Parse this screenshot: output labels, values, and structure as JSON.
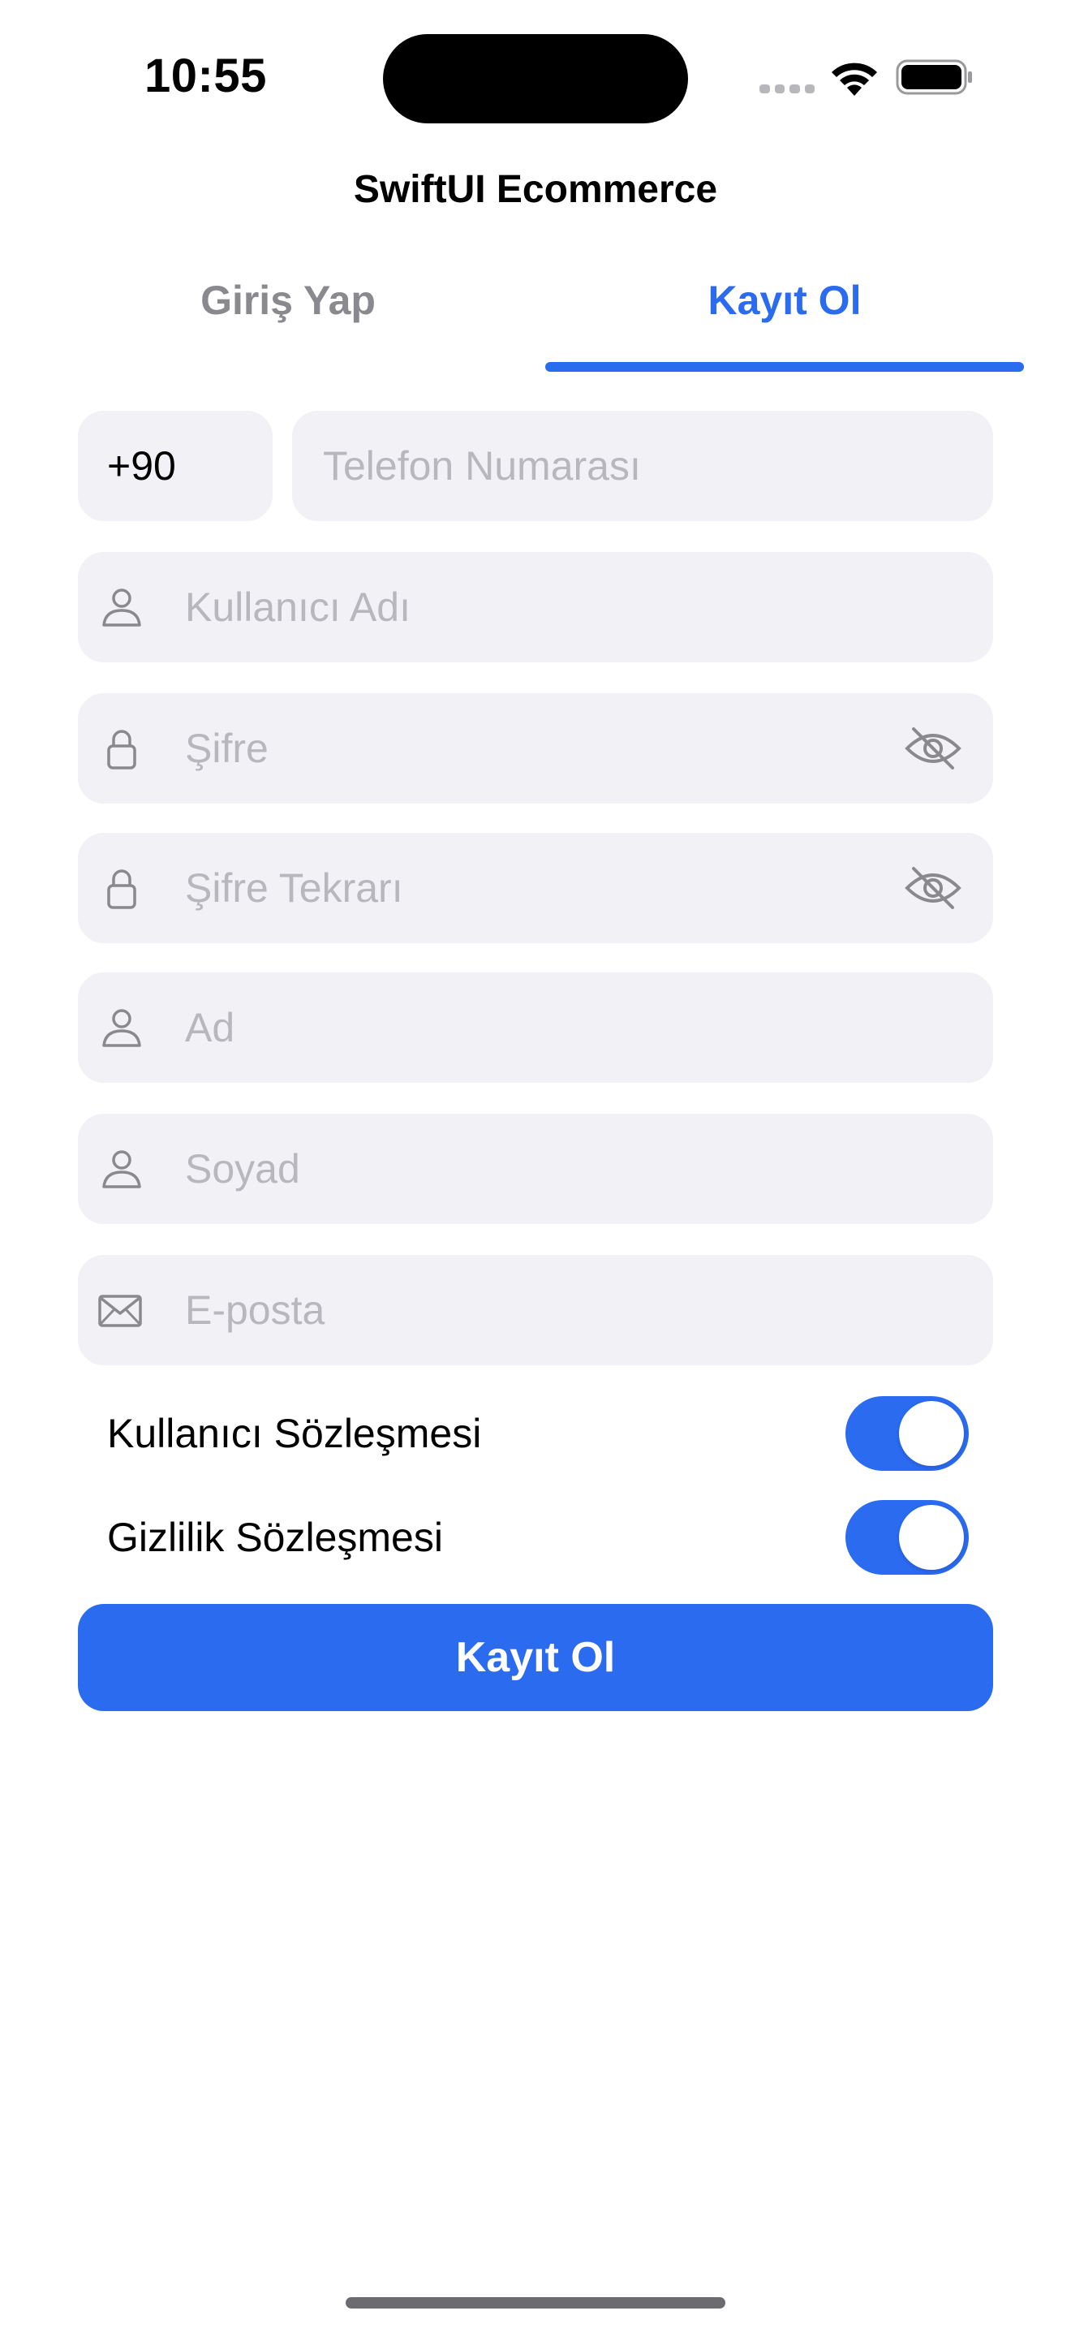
{
  "status_bar": {
    "time": "10:55"
  },
  "app": {
    "title": "SwiftUI Ecommerce"
  },
  "tabs": [
    {
      "label": "Giriş Yap",
      "selected": false
    },
    {
      "label": "Kayıt Ol",
      "selected": true
    }
  ],
  "form": {
    "country_code": "+90",
    "phone_placeholder": "Telefon Numarası",
    "username_placeholder": "Kullanıcı Adı",
    "password_placeholder": "Şifre",
    "password_repeat_placeholder": "Şifre Tekrarı",
    "first_name_placeholder": "Ad",
    "last_name_placeholder": "Soyad",
    "email_placeholder": "E-posta"
  },
  "agreements": [
    {
      "label": "Kullanıcı Sözleşmesi",
      "on": true
    },
    {
      "label": "Gizlilik Sözleşmesi",
      "on": true
    }
  ],
  "submit_label": "Kayıt Ol",
  "colors": {
    "accent": "#2a6bf0",
    "field_background": "#f1f1f6",
    "placeholder": "#b7b7bd",
    "inactive_tab": "#8a8a8e"
  },
  "icons": {
    "username": "person-icon",
    "password": "lock-icon",
    "password_toggle": "eye-slash-icon",
    "email": "envelope-icon"
  }
}
